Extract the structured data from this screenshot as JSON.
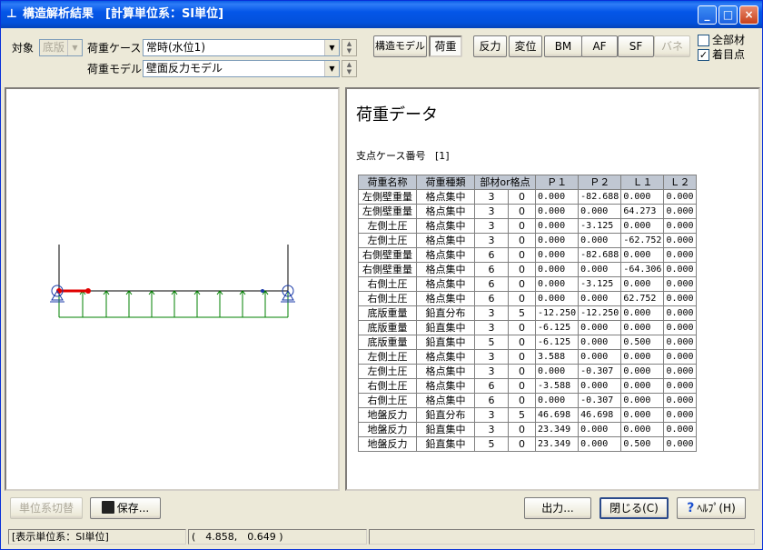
{
  "window": {
    "title": "構造解析結果　[計算単位系：SI単位]",
    "icon": "app-structure-icon",
    "controls": [
      "minimize",
      "maximize",
      "close"
    ]
  },
  "toolbar": {
    "target_label": "対象",
    "target_value": "底版",
    "load_case_label": "荷重ケース",
    "load_case_value": "常時(水位1)",
    "load_model_label": "荷重モデル",
    "load_model_value": "壁面反力モデル",
    "view_buttons": [
      "構造モデル",
      "荷重"
    ],
    "result_buttons": [
      "反力",
      "変位",
      "BM",
      "AF",
      "SF",
      "バネ"
    ],
    "check_all_members": "全部材",
    "check_focus_point": "着目点"
  },
  "right": {
    "title": "荷重データ",
    "case_label": "支点ケース番号",
    "case_value": "[1]",
    "columns": [
      "荷重名称",
      "荷重種類",
      "部材or格点",
      "Ｐ１",
      "Ｐ２",
      "Ｌ１",
      "Ｌ２"
    ],
    "rows": [
      [
        "左側壁重量",
        "格点集中",
        "3",
        "0",
        "0.000",
        "-82.688",
        "0.000",
        "0.000"
      ],
      [
        "左側壁重量",
        "格点集中",
        "3",
        "0",
        "0.000",
        "0.000",
        "64.273",
        "0.000"
      ],
      [
        "左側土圧",
        "格点集中",
        "3",
        "0",
        "0.000",
        "-3.125",
        "0.000",
        "0.000"
      ],
      [
        "左側土圧",
        "格点集中",
        "3",
        "0",
        "0.000",
        "0.000",
        "-62.752",
        "0.000"
      ],
      [
        "右側壁重量",
        "格点集中",
        "6",
        "0",
        "0.000",
        "-82.688",
        "0.000",
        "0.000"
      ],
      [
        "右側壁重量",
        "格点集中",
        "6",
        "0",
        "0.000",
        "0.000",
        "-64.306",
        "0.000"
      ],
      [
        "右側土圧",
        "格点集中",
        "6",
        "0",
        "0.000",
        "-3.125",
        "0.000",
        "0.000"
      ],
      [
        "右側土圧",
        "格点集中",
        "6",
        "0",
        "0.000",
        "0.000",
        "62.752",
        "0.000"
      ],
      [
        "底版重量",
        "鉛直分布",
        "3",
        "5",
        "-12.250",
        "-12.250",
        "0.000",
        "0.000"
      ],
      [
        "底版重量",
        "鉛直集中",
        "3",
        "0",
        "-6.125",
        "0.000",
        "0.000",
        "0.000"
      ],
      [
        "底版重量",
        "鉛直集中",
        "5",
        "0",
        "-6.125",
        "0.000",
        "0.500",
        "0.000"
      ],
      [
        "左側土圧",
        "格点集中",
        "3",
        "0",
        "3.588",
        "0.000",
        "0.000",
        "0.000"
      ],
      [
        "左側土圧",
        "格点集中",
        "3",
        "0",
        "0.000",
        "-0.307",
        "0.000",
        "0.000"
      ],
      [
        "右側土圧",
        "格点集中",
        "6",
        "0",
        "-3.588",
        "0.000",
        "0.000",
        "0.000"
      ],
      [
        "右側土圧",
        "格点集中",
        "6",
        "0",
        "0.000",
        "-0.307",
        "0.000",
        "0.000"
      ],
      [
        "地盤反力",
        "鉛直分布",
        "3",
        "5",
        "46.698",
        "46.698",
        "0.000",
        "0.000"
      ],
      [
        "地盤反力",
        "鉛直集中",
        "3",
        "0",
        "23.349",
        "0.000",
        "0.000",
        "0.000"
      ],
      [
        "地盤反力",
        "鉛直集中",
        "5",
        "0",
        "23.349",
        "0.000",
        "0.500",
        "0.000"
      ]
    ]
  },
  "bottom": {
    "unit_switch": "単位系切替",
    "save": "保存...",
    "output": "出力...",
    "close": "閉じる(C)",
    "help": "ﾍﾙﾌﾟ(H)"
  },
  "status": {
    "unit": "[表示単位系：SI単位]",
    "coords": "(　4.858,　0.649 )"
  },
  "colors": {
    "title_bar": "#0454e3",
    "member_red": "#e00000",
    "load_green": "#008000",
    "support_blue": "#1a3aa8"
  }
}
